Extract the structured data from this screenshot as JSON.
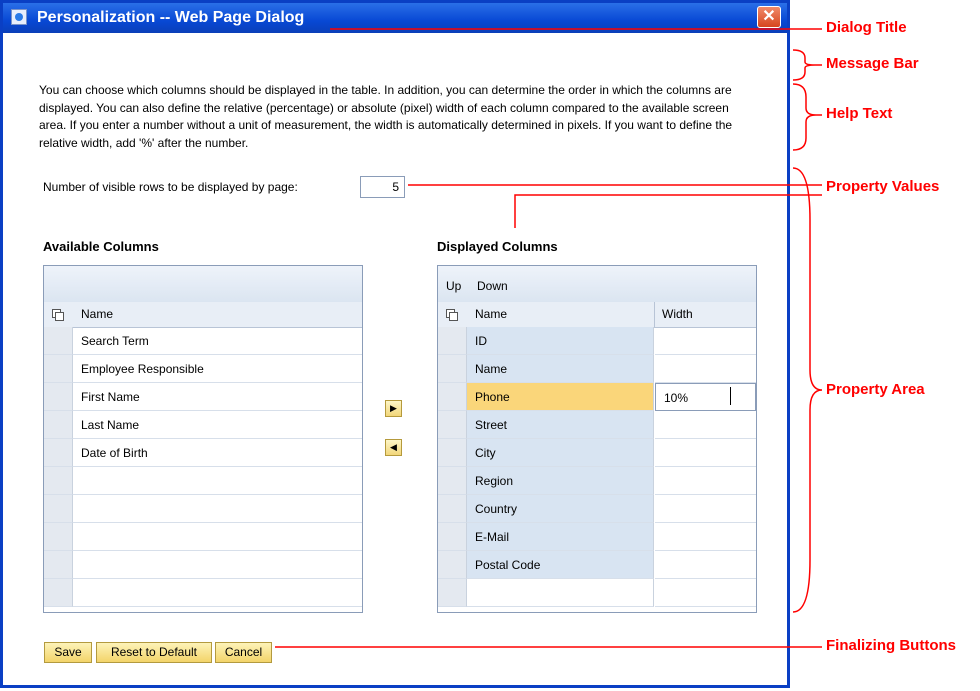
{
  "dialog": {
    "title": "Personalization -- Web Page Dialog",
    "close_symbol": "✕",
    "help_text": "You can choose which columns should be displayed in the table. In addition, you can determine the order in which the columns are displayed. You can also define the relative (percentage) or absolute (pixel) width of each column compared to the available screen area. If you enter a number without a unit of measurement, the width is automatically determined in pixels. If you want to define the relative width, add '%' after the number.",
    "rows_label": "Number of visible rows to be displayed by page:",
    "rows_value": "5"
  },
  "available": {
    "title": "Available Columns",
    "header_name": "Name",
    "rows": [
      "Search Term",
      "Employee Responsible",
      "First Name",
      "Last Name",
      "Date of Birth",
      "",
      "",
      "",
      "",
      ""
    ]
  },
  "displayed": {
    "title": "Displayed Columns",
    "up_label": "Up",
    "down_label": "Down",
    "header_name": "Name",
    "header_width": "Width",
    "rows": [
      {
        "name": "ID",
        "width": ""
      },
      {
        "name": "Name",
        "width": ""
      },
      {
        "name": "Phone",
        "width": "10%"
      },
      {
        "name": "Street",
        "width": ""
      },
      {
        "name": "City",
        "width": ""
      },
      {
        "name": "Region",
        "width": ""
      },
      {
        "name": "Country",
        "width": ""
      },
      {
        "name": "E-Mail",
        "width": ""
      },
      {
        "name": "Postal Code",
        "width": ""
      },
      {
        "name": "",
        "width": ""
      }
    ]
  },
  "move": {
    "right_symbol": "▶",
    "left_symbol": "◀"
  },
  "buttons": {
    "save": "Save",
    "reset": "Reset to Default",
    "cancel": "Cancel"
  },
  "annotations": {
    "dialog_title": "Dialog Title",
    "message_bar": "Message Bar",
    "help_text": "Help Text",
    "property_values": "Property Values",
    "property_area": "Property Area",
    "finalizing_buttons": "Finalizing Buttons"
  },
  "colors": {
    "titlebar": "#0848d4",
    "annotation": "#ff0000",
    "selected_row": "#fad67a",
    "name_column": "#d8e4f2"
  }
}
